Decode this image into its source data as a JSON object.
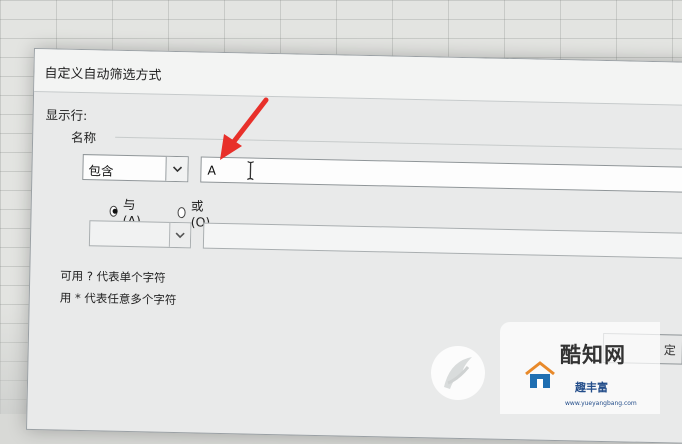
{
  "dialog": {
    "title": "自定义自动筛选方式",
    "show_rows_label": "显示行:",
    "field_name": "名称",
    "row1": {
      "operator": "包含",
      "value": "A"
    },
    "logic": {
      "and_label": "与(A)",
      "or_label": "或(O)",
      "selected": "and"
    },
    "row2": {
      "operator": "",
      "value": ""
    },
    "hint_single": "可用 ? 代表单个字符",
    "hint_multi": "用 * 代表任意多个字符",
    "ok_label": "定"
  },
  "watermark": {
    "title": "酷知网",
    "sub": "趣丰富",
    "url": "www.yueyangbang.com"
  },
  "colors": {
    "arrow": "#e8302a",
    "brand_blue": "#234d8a"
  }
}
